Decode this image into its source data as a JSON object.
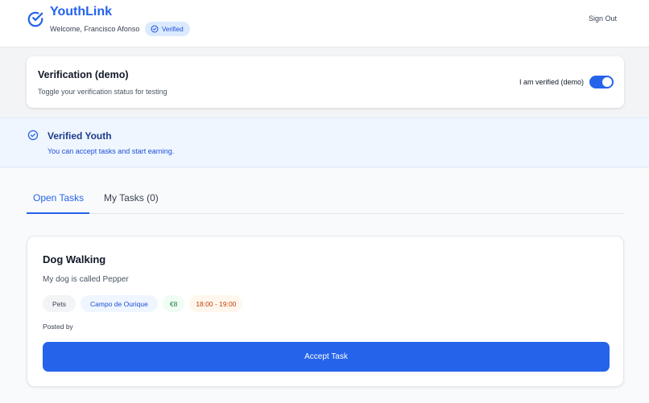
{
  "header": {
    "app_name": "YouthLink",
    "welcome": "Welcome, Francisco Afonso",
    "badge": "Verified",
    "sign_out": "Sign Out"
  },
  "verification": {
    "title": "Verification (demo)",
    "subtitle": "Toggle your verification status for testing",
    "toggle_label": "I am verified (demo)",
    "toggle_on": true
  },
  "status": {
    "title": "Verified Youth",
    "message": "You can accept tasks and start earning."
  },
  "tabs": [
    {
      "label": "Open Tasks",
      "active": true
    },
    {
      "label": "My Tasks (0)",
      "active": false
    }
  ],
  "task": {
    "title": "Dog Walking",
    "description": "My dog is called Pepper",
    "category": "Pets",
    "location": "Campo de Ourique",
    "price": "€8",
    "time": "18:00 - 19:00",
    "posted_by": "Posted by",
    "accept_label": "Accept Task"
  },
  "colors": {
    "primary": "#2563eb",
    "banner_bg": "#eff6ff",
    "background": "#f3f4f6"
  },
  "icons": {
    "logo": "check-circle-icon",
    "badge": "check-circle-icon",
    "status": "check-circle-icon"
  }
}
